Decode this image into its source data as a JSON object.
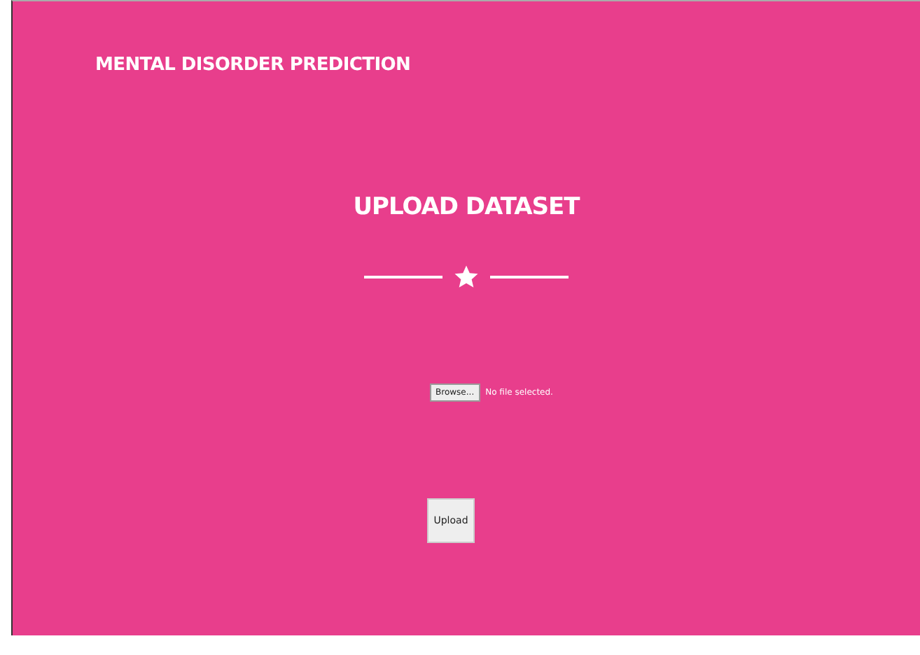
{
  "header": {
    "title": "MENTAL DISORDER PREDICTION"
  },
  "section": {
    "heading": "UPLOAD DATASET"
  },
  "form": {
    "file_button": "Browse...",
    "file_status": "No file selected.",
    "submit": "Upload"
  }
}
